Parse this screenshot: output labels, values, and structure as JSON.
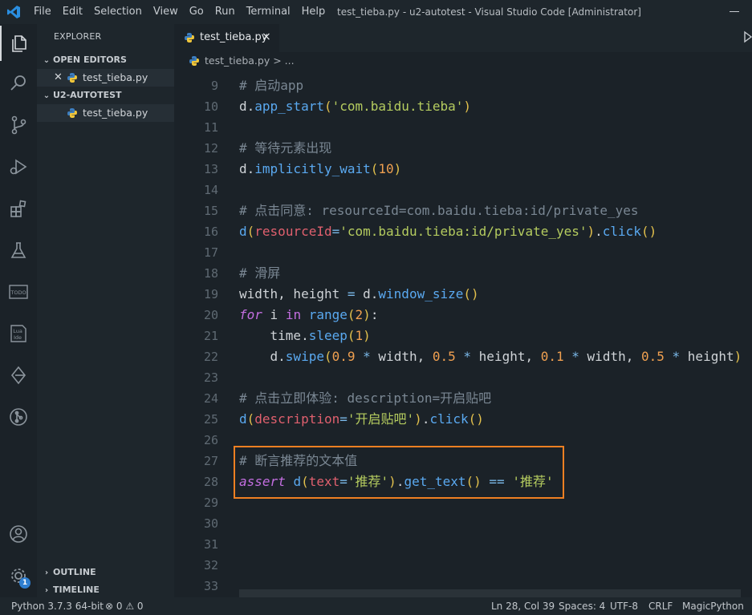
{
  "titlebar": {
    "menu": [
      "File",
      "Edit",
      "Selection",
      "View",
      "Go",
      "Run",
      "Terminal",
      "Help"
    ],
    "title": "test_tieba.py - u2-autotest - Visual Studio Code [Administrator]"
  },
  "activity_icons": [
    "files-icon",
    "search-icon",
    "source-control-icon",
    "run-debug-icon",
    "extensions-icon",
    "testing-flask-icon",
    "todo-icon",
    "lua-ide-icon",
    "remote-icon",
    "git-graph-icon",
    "account-icon",
    "settings-gear-icon"
  ],
  "activity": {
    "todo_label": "TODO",
    "lua_label": "Lua",
    "ide_label": "Ide",
    "settings_badge": "1"
  },
  "sidebar": {
    "title": "EXPLORER",
    "open_editors_label": "OPEN EDITORS",
    "open_editors_file": "test_tieba.py",
    "project_label": "U2-AUTOTEST",
    "project_file": "test_tieba.py",
    "outline_label": "OUTLINE",
    "timeline_label": "TIMELINE"
  },
  "tab": {
    "label": "test_tieba.py",
    "close": "×"
  },
  "breadcrumb": {
    "file": "test_tieba.py",
    "rest": " > ..."
  },
  "editor": {
    "lines": [
      {
        "n": "9",
        "tokens": [
          [
            "c-com",
            "# 启动app"
          ]
        ]
      },
      {
        "n": "10",
        "tokens": [
          [
            "c-var",
            "d."
          ],
          [
            "c-fn",
            "app_start"
          ],
          [
            "c-par",
            "("
          ],
          [
            "c-str",
            "'com.baidu.tieba'"
          ],
          [
            "c-par",
            ")"
          ]
        ]
      },
      {
        "n": "11",
        "tokens": []
      },
      {
        "n": "12",
        "tokens": [
          [
            "c-com",
            "# 等待元素出现"
          ]
        ]
      },
      {
        "n": "13",
        "tokens": [
          [
            "c-var",
            "d."
          ],
          [
            "c-fn",
            "implicitly_wait"
          ],
          [
            "c-par",
            "("
          ],
          [
            "c-num",
            "10"
          ],
          [
            "c-par",
            ")"
          ]
        ]
      },
      {
        "n": "14",
        "tokens": []
      },
      {
        "n": "15",
        "tokens": [
          [
            "c-com",
            "# 点击同意: resourceId=com.baidu.tieba:id/private_yes"
          ]
        ]
      },
      {
        "n": "16",
        "tokens": [
          [
            "c-fn",
            "d"
          ],
          [
            "c-par",
            "("
          ],
          [
            "c-param",
            "resourceId"
          ],
          [
            "c-op",
            "="
          ],
          [
            "c-str",
            "'com.baidu.tieba:id/private_yes'"
          ],
          [
            "c-par",
            ")"
          ],
          [
            "c-var",
            "."
          ],
          [
            "c-fn",
            "click"
          ],
          [
            "c-par",
            "()"
          ]
        ]
      },
      {
        "n": "17",
        "tokens": []
      },
      {
        "n": "18",
        "tokens": [
          [
            "c-com",
            "# 滑屏"
          ]
        ]
      },
      {
        "n": "19",
        "tokens": [
          [
            "c-var",
            "width, height "
          ],
          [
            "c-op",
            "="
          ],
          [
            "c-var",
            " d."
          ],
          [
            "c-fn",
            "window_size"
          ],
          [
            "c-par",
            "()"
          ]
        ]
      },
      {
        "n": "20",
        "tokens": [
          [
            "c-kw",
            "for"
          ],
          [
            "c-var",
            " i "
          ],
          [
            "c-kw2",
            "in"
          ],
          [
            "c-var",
            " "
          ],
          [
            "c-fn",
            "range"
          ],
          [
            "c-par",
            "("
          ],
          [
            "c-num",
            "2"
          ],
          [
            "c-par",
            ")"
          ],
          [
            "c-var",
            ":"
          ]
        ]
      },
      {
        "n": "21",
        "tokens": [
          [
            "c-var",
            "    time."
          ],
          [
            "c-fn",
            "sleep"
          ],
          [
            "c-par",
            "("
          ],
          [
            "c-num",
            "1"
          ],
          [
            "c-par",
            ")"
          ]
        ]
      },
      {
        "n": "22",
        "tokens": [
          [
            "c-var",
            "    d."
          ],
          [
            "c-fn",
            "swipe"
          ],
          [
            "c-par",
            "("
          ],
          [
            "c-num",
            "0.9"
          ],
          [
            "c-op",
            " * "
          ],
          [
            "c-var",
            "width, "
          ],
          [
            "c-num",
            "0.5"
          ],
          [
            "c-op",
            " * "
          ],
          [
            "c-var",
            "height, "
          ],
          [
            "c-num",
            "0.1"
          ],
          [
            "c-op",
            " * "
          ],
          [
            "c-var",
            "width, "
          ],
          [
            "c-num",
            "0.5"
          ],
          [
            "c-op",
            " * "
          ],
          [
            "c-var",
            "height"
          ],
          [
            "c-par",
            ")"
          ]
        ]
      },
      {
        "n": "23",
        "tokens": []
      },
      {
        "n": "24",
        "tokens": [
          [
            "c-com",
            "# 点击立即体验: description=开启贴吧"
          ]
        ]
      },
      {
        "n": "25",
        "tokens": [
          [
            "c-fn",
            "d"
          ],
          [
            "c-par",
            "("
          ],
          [
            "c-param",
            "description"
          ],
          [
            "c-op",
            "="
          ],
          [
            "c-str",
            "'开启贴吧'"
          ],
          [
            "c-par",
            ")"
          ],
          [
            "c-var",
            "."
          ],
          [
            "c-fn",
            "click"
          ],
          [
            "c-par",
            "()"
          ]
        ]
      },
      {
        "n": "26",
        "tokens": []
      },
      {
        "n": "27",
        "tokens": [
          [
            "c-com",
            "# 断言推荐的文本值"
          ]
        ]
      },
      {
        "n": "28",
        "tokens": [
          [
            "c-kw",
            "assert"
          ],
          [
            "c-var",
            " "
          ],
          [
            "c-fn",
            "d"
          ],
          [
            "c-par",
            "("
          ],
          [
            "c-param",
            "text"
          ],
          [
            "c-op",
            "="
          ],
          [
            "c-str",
            "'推荐'"
          ],
          [
            "c-par",
            ")"
          ],
          [
            "c-var",
            "."
          ],
          [
            "c-fn",
            "get_text"
          ],
          [
            "c-par",
            "()"
          ],
          [
            "c-op",
            " == "
          ],
          [
            "c-str",
            "'推荐'"
          ]
        ]
      },
      {
        "n": "29",
        "tokens": []
      },
      {
        "n": "30",
        "tokens": []
      },
      {
        "n": "31",
        "tokens": []
      },
      {
        "n": "32",
        "tokens": []
      },
      {
        "n": "33",
        "tokens": []
      }
    ]
  },
  "statusbar": {
    "interpreter": "Python 3.7.3 64-bit",
    "problems": "⊗ 0 ⚠ 0",
    "cursor": "Ln 28, Col 39",
    "spaces": "Spaces: 4",
    "encoding": "UTF-8",
    "eol": "CRLF",
    "language": "MagicPython"
  },
  "colors": {
    "highlight_border": "#ef7f22",
    "background": "#1b2228",
    "badge": "#2f7fd1"
  }
}
